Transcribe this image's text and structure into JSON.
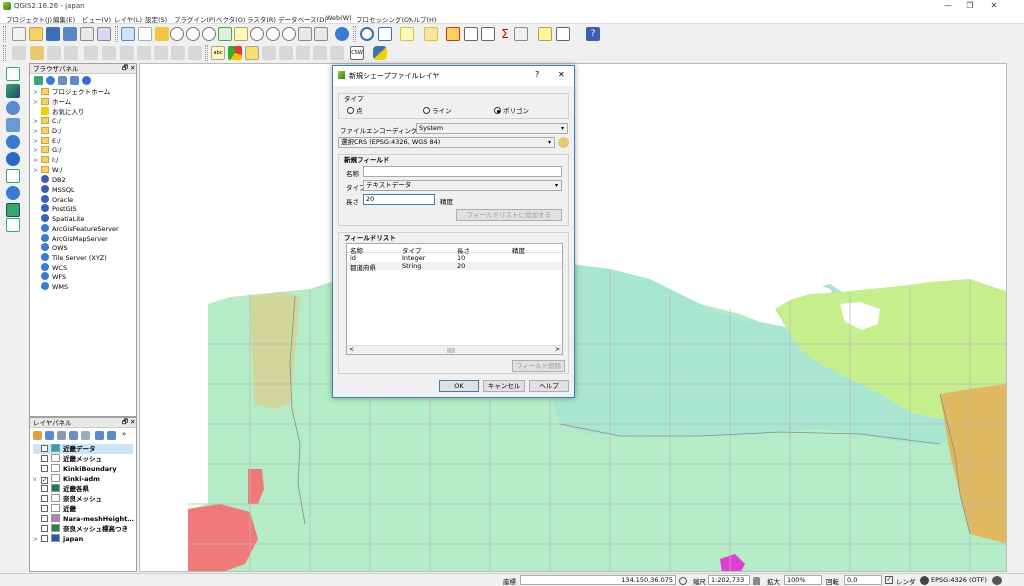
{
  "window": {
    "title": "QGIS2.16.26 - japan",
    "min": "—",
    "max": "❐",
    "close": "✕"
  },
  "menu": [
    "プロジェクト(J)",
    "編集(E)",
    "ビュー(V)",
    "レイヤ(L)",
    "設定(S)",
    "プラグイン(P)",
    "ベクタ(O)",
    "ラスタ(R)",
    "データベース(D)",
    "Web(W)",
    "プロセッシング(C)",
    "ヘルプ(H)"
  ],
  "toolbar2_text": {
    "csw": "CSW",
    "abc": "abc"
  },
  "browser": {
    "title": "ブラウザパネル",
    "close": "✕",
    "float": "🗗",
    "items": [
      {
        "label": "プロジェクトホーム",
        "type": "folder",
        "arrow": ">"
      },
      {
        "label": "ホーム",
        "type": "folder",
        "arrow": ">"
      },
      {
        "label": "お気に入り",
        "type": "star",
        "arrow": ""
      },
      {
        "label": "C:/",
        "type": "folder",
        "arrow": ">"
      },
      {
        "label": "D:/",
        "type": "folder",
        "arrow": ">"
      },
      {
        "label": "E:/",
        "type": "folder",
        "arrow": ">"
      },
      {
        "label": "G:/",
        "type": "folder",
        "arrow": ">"
      },
      {
        "label": "I:/",
        "type": "folder",
        "arrow": ">"
      },
      {
        "label": "W:/",
        "type": "folder",
        "arrow": ">"
      },
      {
        "label": "DB2",
        "type": "db",
        "arrow": ""
      },
      {
        "label": "MSSQL",
        "type": "db",
        "arrow": ""
      },
      {
        "label": "Oracle",
        "type": "db",
        "arrow": ""
      },
      {
        "label": "PostGIS",
        "type": "db",
        "arrow": ""
      },
      {
        "label": "SpatiaLite",
        "type": "db",
        "arrow": ""
      },
      {
        "label": "ArcGisFeatureServer",
        "type": "svc",
        "arrow": ""
      },
      {
        "label": "ArcGisMapServer",
        "type": "svc",
        "arrow": ""
      },
      {
        "label": "OWS",
        "type": "svc",
        "arrow": ""
      },
      {
        "label": "Tile Server (XYZ)",
        "type": "svc",
        "arrow": ""
      },
      {
        "label": "WCS",
        "type": "svc",
        "arrow": ""
      },
      {
        "label": "WFS",
        "type": "svc",
        "arrow": ""
      },
      {
        "label": "WMS",
        "type": "svc",
        "arrow": ""
      }
    ]
  },
  "layers": {
    "title": "レイヤパネル",
    "close": "✕",
    "float": "🗗",
    "items": [
      {
        "label": "近畿データ",
        "checked": false,
        "color": "#2aa6a6",
        "bold": true,
        "selected": true
      },
      {
        "label": "近畿メッシュ",
        "checked": false,
        "color": "#ffffff",
        "bold": true
      },
      {
        "label": "KinkiBoundary",
        "checked": false,
        "color": "#ffffff",
        "bold": true
      },
      {
        "label": "Kinki-adm",
        "checked": true,
        "color": "#ffffff",
        "bold": true,
        "arrow": "v"
      },
      {
        "label": "近畿各県",
        "checked": false,
        "color": "#1f7a5a",
        "bold": true
      },
      {
        "label": "奈良メッシュ",
        "checked": false,
        "color": "#ffffff",
        "bold": true
      },
      {
        "label": "近畿",
        "checked": false,
        "color": "#ffffff",
        "bold": true
      },
      {
        "label": "Nara-meshHeight…",
        "checked": false,
        "color": "#b080c0",
        "bold": true
      },
      {
        "label": "奈良メッシュ標高つき",
        "checked": false,
        "color": "#228844",
        "bold": true
      },
      {
        "label": "japan",
        "checked": false,
        "color": "#3355aa",
        "bold": true,
        "arrow": ">"
      }
    ]
  },
  "dialog": {
    "title": "新規シェープファイルレイヤ",
    "help": "?",
    "close": "✕",
    "type_group": "タイプ",
    "types": [
      {
        "label": "点",
        "selected": false
      },
      {
        "label": "ライン",
        "selected": false
      },
      {
        "label": "ポリゴン",
        "selected": true
      }
    ],
    "encoding_label": "ファイルエンコーディング",
    "encoding_value": "System",
    "crs_value": "選択CRS (EPSG:4326, WGS 84)",
    "new_field_group": "新規フィールド",
    "name_label": "名称",
    "name_value": "",
    "type_label": "タイプ",
    "type_value": "テキストデータ",
    "length_label": "長さ",
    "length_value": "20",
    "precision_label": "精度",
    "add_button": "フィールドリストに追加する",
    "field_list_group": "フィールドリスト",
    "columns": [
      "名称",
      "タイプ",
      "長さ",
      "精度"
    ],
    "rows": [
      [
        "id",
        "Integer",
        "10",
        ""
      ],
      [
        "都道府県",
        "String",
        "20",
        ""
      ]
    ],
    "remove_button": "フィールド削除",
    "ok": "OK",
    "cancel": "キャンセル",
    "help_btn": "ヘルプ"
  },
  "status": {
    "coord_label": "座標",
    "coord_value": "134.150,36.075",
    "scale_label": "縮尺",
    "scale_value": "1:202,733",
    "zoom_label": "拡大",
    "zoom_value": "100%",
    "rot_label": "回転",
    "rot_value": "0.0",
    "render_label": "レンダ",
    "crs": "EPSG:4326 (OTF)"
  },
  "colors": {
    "sea": "#ffffff",
    "green_light": "#c6ee8c",
    "teal": "#a8e6d2",
    "mint": "#b3ecc6",
    "olive": "#d1d79a",
    "salmon": "#f07a7a",
    "orange": "#e0b860",
    "magenta": "#e040d0",
    "grid": "#b9b9b9"
  }
}
